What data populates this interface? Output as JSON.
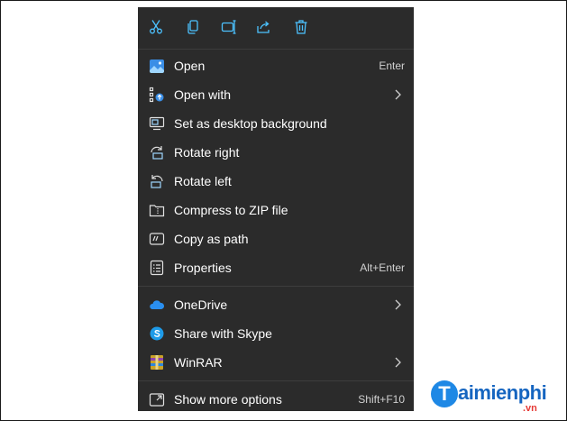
{
  "menu": {
    "toolbar": [
      {
        "name": "cut-icon"
      },
      {
        "name": "copy-icon"
      },
      {
        "name": "rename-icon"
      },
      {
        "name": "share-icon"
      },
      {
        "name": "delete-icon"
      }
    ],
    "items": [
      {
        "label": "Open",
        "shortcut": "Enter",
        "icon": "photos-icon"
      },
      {
        "label": "Open with",
        "shortcut": "",
        "icon": "open-with-icon",
        "submenu": true
      },
      {
        "label": "Set as desktop background",
        "shortcut": "",
        "icon": "desktop-background-icon"
      },
      {
        "label": "Rotate right",
        "shortcut": "",
        "icon": "rotate-right-icon"
      },
      {
        "label": "Rotate left",
        "shortcut": "",
        "icon": "rotate-left-icon"
      },
      {
        "label": "Compress to ZIP file",
        "shortcut": "",
        "icon": "zip-folder-icon"
      },
      {
        "label": "Copy as path",
        "shortcut": "",
        "icon": "copy-path-icon"
      },
      {
        "label": "Properties",
        "shortcut": "Alt+Enter",
        "icon": "properties-icon"
      },
      {
        "label": "OneDrive",
        "shortcut": "",
        "icon": "onedrive-icon",
        "submenu": true
      },
      {
        "label": "Share with Skype",
        "shortcut": "",
        "icon": "skype-icon"
      },
      {
        "label": "WinRAR",
        "shortcut": "",
        "icon": "winrar-icon",
        "submenu": true
      },
      {
        "label": "Show more options",
        "shortcut": "Shift+F10",
        "icon": "show-more-options-icon"
      }
    ]
  },
  "watermark": {
    "brand_initial": "T",
    "brand_text": "aimienphi",
    "brand_suffix": ".vn"
  },
  "colors": {
    "menu_bg": "#2b2b2b",
    "separator": "#3d3d3d",
    "accent_blue": "#4cc2ff",
    "brand_blue": "#1565c0",
    "brand_red": "#e53935"
  }
}
